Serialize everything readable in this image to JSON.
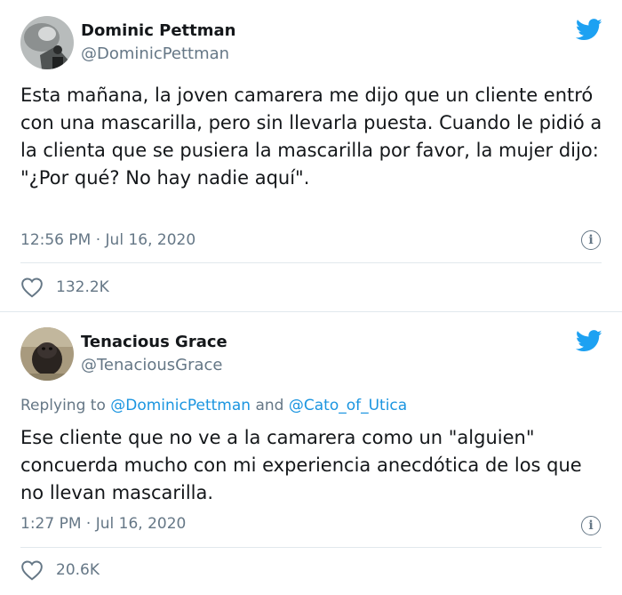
{
  "tweets": [
    {
      "name": "Dominic Pettman",
      "handle": "@DominicPettman",
      "text": "Esta mañana, la joven camarera me dijo que un cliente entró con una mascarilla, pero sin llevarla puesta. Cuando le pidió a la clienta que se pusiera la mascarilla por favor, la mujer dijo: \"¿Por qué? No hay nadie aquí\".",
      "timestamp": "12:56 PM · Jul 16, 2020",
      "likes": "132.2K"
    },
    {
      "name": "Tenacious Grace",
      "handle": "@TenaciousGrace",
      "reply": {
        "prefix": "Replying to",
        "mention_1": "@DominicPettman",
        "joiner": "and",
        "mention_2": "@Cato_of_Utica"
      },
      "text": "Ese cliente que no ve a la camarera como un \"alguien\" concuerda mucho con mi experiencia anecdótica de los que no llevan mascarilla.",
      "timestamp": "1:27 PM · Jul 16, 2020",
      "likes": "20.6K"
    }
  ],
  "colors": {
    "twitter_blue": "#1da1f2",
    "mention_blue": "#1b95e0",
    "muted_gray": "#657786",
    "text_dark": "#14171a",
    "divider": "#e1e8ed"
  },
  "icons": {
    "brand": "twitter-bird-icon",
    "info": "info-icon",
    "like": "heart-icon"
  }
}
